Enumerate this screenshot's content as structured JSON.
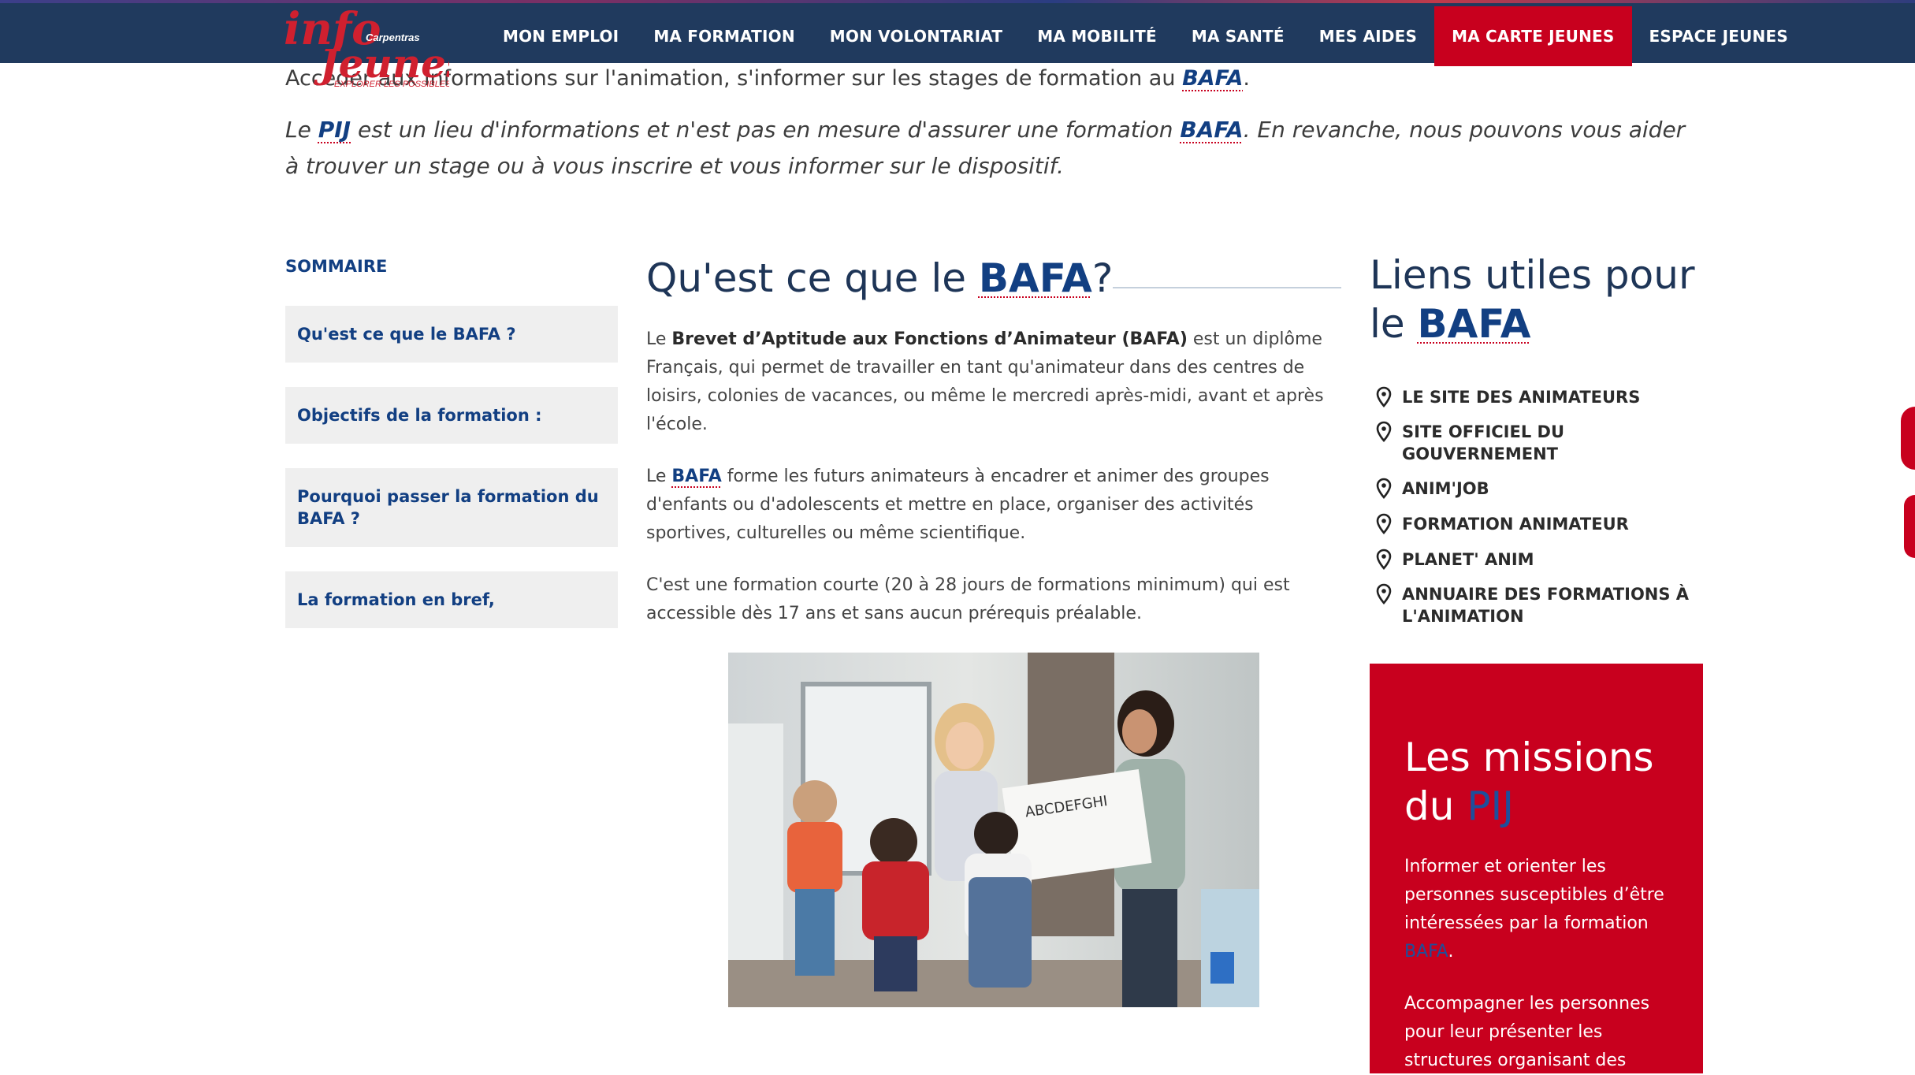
{
  "logo": {
    "line1": "info",
    "line2": "Jeunes",
    "town": "Carpentras",
    "tagline": "EXPLORER LES POSSIBLES"
  },
  "nav": [
    {
      "label": "MON EMPLOI",
      "active": false
    },
    {
      "label": "MA FORMATION",
      "active": false
    },
    {
      "label": "MON VOLONTARIAT",
      "active": false
    },
    {
      "label": "MA MOBILITÉ",
      "active": false
    },
    {
      "label": "MA SANTÉ",
      "active": false
    },
    {
      "label": "MES AIDES",
      "active": false
    },
    {
      "label": "MA CARTE JEUNES",
      "active": true
    },
    {
      "label": "ESPACE JEUNES",
      "active": false
    }
  ],
  "intro": {
    "line1_pre": "Accéder aux informations sur l'animation, s'informer sur les stages de formation au ",
    "line1_kw": "BAFA",
    "line1_post": ".",
    "p2_pre": "Le ",
    "p2_kw1": "PIJ",
    "p2_mid": " est un lieu d'informations et n'est pas en mesure d'assurer une formation ",
    "p2_kw2": "BAFA",
    "p2_post": ". En revanche, nous pouvons vous aider à trouver un stage ou à vous inscrire et vous informer sur le dispositif."
  },
  "sommaire": {
    "title": "SOMMAIRE",
    "items": [
      "Qu'est ce que le BAFA ?",
      "Objectifs de la formation :",
      "Pourquoi passer la formation du BAFA ?",
      "La formation en bref,"
    ]
  },
  "main": {
    "heading_pre": "Qu'est ce que le ",
    "heading_kw": "BAFA",
    "heading_post": " ?",
    "p1_pre": "Le ",
    "p1_bold": "Brevet d’Aptitude aux Fonctions d’Animateur (BAFA)",
    "p1_post": " est un diplôme Français, qui permet de travailler en tant qu'animateur dans des centres de loisirs, colonies de vacances, ou même le mercredi après-midi, avant et après l'école.",
    "p2_pre": "Le ",
    "p2_kw": "BAFA",
    "p2_post": " forme les futurs animateurs à encadrer et animer des groupes d'enfants ou d'adolescents et mettre en place, organiser des activités sportives, culturelles ou même scientifique.",
    "p3": "C'est une formation courte (20 à 28 jours de formations minimum) qui est accessible dès 17 ans et sans aucun prérequis préalable."
  },
  "liens": {
    "title_pre": "Liens utiles pour le ",
    "title_kw": "BAFA",
    "items": [
      "LE SITE DES ANIMATEURS",
      "SITE OFFICIEL DU GOUVERNEMENT",
      "ANIM'JOB",
      "FORMATION ANIMATEUR",
      "PLANET' ANIM",
      "ANNUAIRE DES FORMATIONS À L'ANIMATION"
    ]
  },
  "missions": {
    "title_pre": "Les missions du ",
    "title_kw": "PIJ",
    "p1_pre": "Informer et orienter les personnes susceptibles d’être intéressées par la formation ",
    "p1_kw": "BAFA",
    "p1_post": ".",
    "p2": "Accompagner les personnes pour leur présenter les structures organisant des"
  },
  "colors": {
    "navy": "#203a5e",
    "red": "#c8001e",
    "link_blue": "#123f82"
  }
}
